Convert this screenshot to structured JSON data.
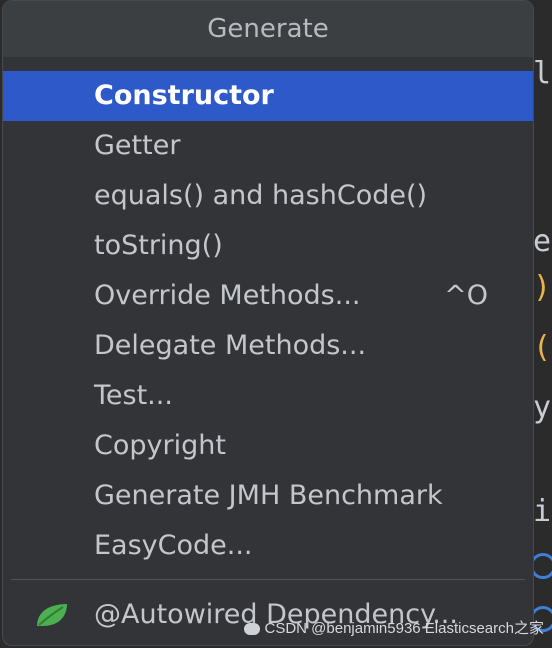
{
  "popup": {
    "title": "Generate",
    "items": [
      {
        "label": "Constructor",
        "selected": true
      },
      {
        "label": "Getter"
      },
      {
        "label": "equals() and hashCode()"
      },
      {
        "label": "toString()"
      },
      {
        "label": "Override Methods...",
        "shortcut": "^O"
      },
      {
        "label": "Delegate Methods..."
      },
      {
        "label": "Test..."
      },
      {
        "label": "Copyright"
      },
      {
        "label": "Generate JMH Benchmark"
      },
      {
        "label": "EasyCode..."
      }
    ],
    "extra_item": {
      "label": "@Autowired Dependency...",
      "icon": "spring-leaf-icon"
    }
  },
  "editor_fragments": {
    "top": "l",
    "mid": "e",
    "y": "y",
    "i": "i"
  },
  "watermark": "CSDN @benjamin5936  Elasticsearch之家",
  "colors": {
    "selection": "#2e5ac9",
    "popup_bg": "#323438",
    "leaf": "#4caf50"
  }
}
